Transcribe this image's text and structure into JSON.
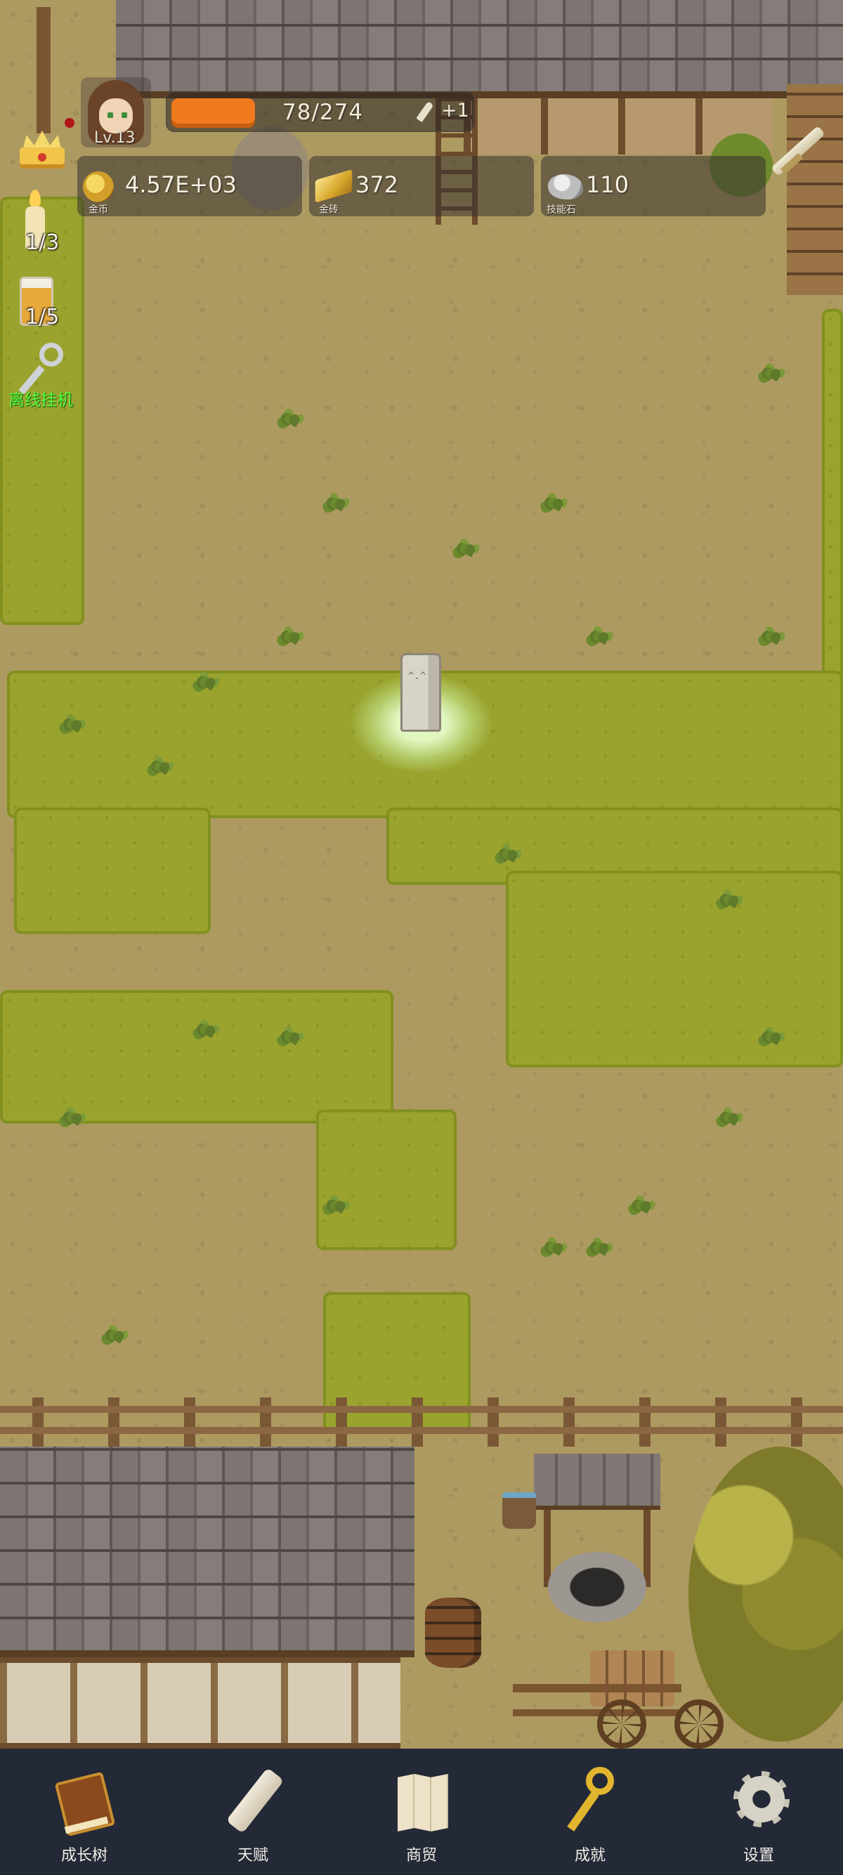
{
  "hud": {
    "player": {
      "level": "Lv.13"
    },
    "xp": {
      "text": "78/274",
      "bonus": "+1",
      "progress": 0.28
    },
    "resources": [
      {
        "icon": "gold-coin-icon",
        "value": "4.57E+03",
        "label": "金币"
      },
      {
        "icon": "gold-brick-icon",
        "value": "372",
        "label": "金砖"
      },
      {
        "icon": "skill-stone-icon",
        "value": "110",
        "label": "技能石"
      }
    ],
    "side": {
      "candle_count": "1/3",
      "beer_count": "1/5",
      "idle_label": "离线挂机"
    }
  },
  "nav": {
    "items": [
      {
        "icon": "book-icon",
        "label": "成长树"
      },
      {
        "icon": "scroll-icon",
        "label": "天赋"
      },
      {
        "icon": "map-icon",
        "label": "商贸"
      },
      {
        "icon": "golden-key-icon",
        "label": "成就"
      },
      {
        "icon": "gear-icon",
        "label": "设置"
      }
    ]
  },
  "colors": {
    "xp_bar": "#f07a1e",
    "grass": "#9aa32e",
    "dirt": "#ad9a61",
    "nav_bg": "#232936",
    "idle_text": "#53ff3c"
  }
}
